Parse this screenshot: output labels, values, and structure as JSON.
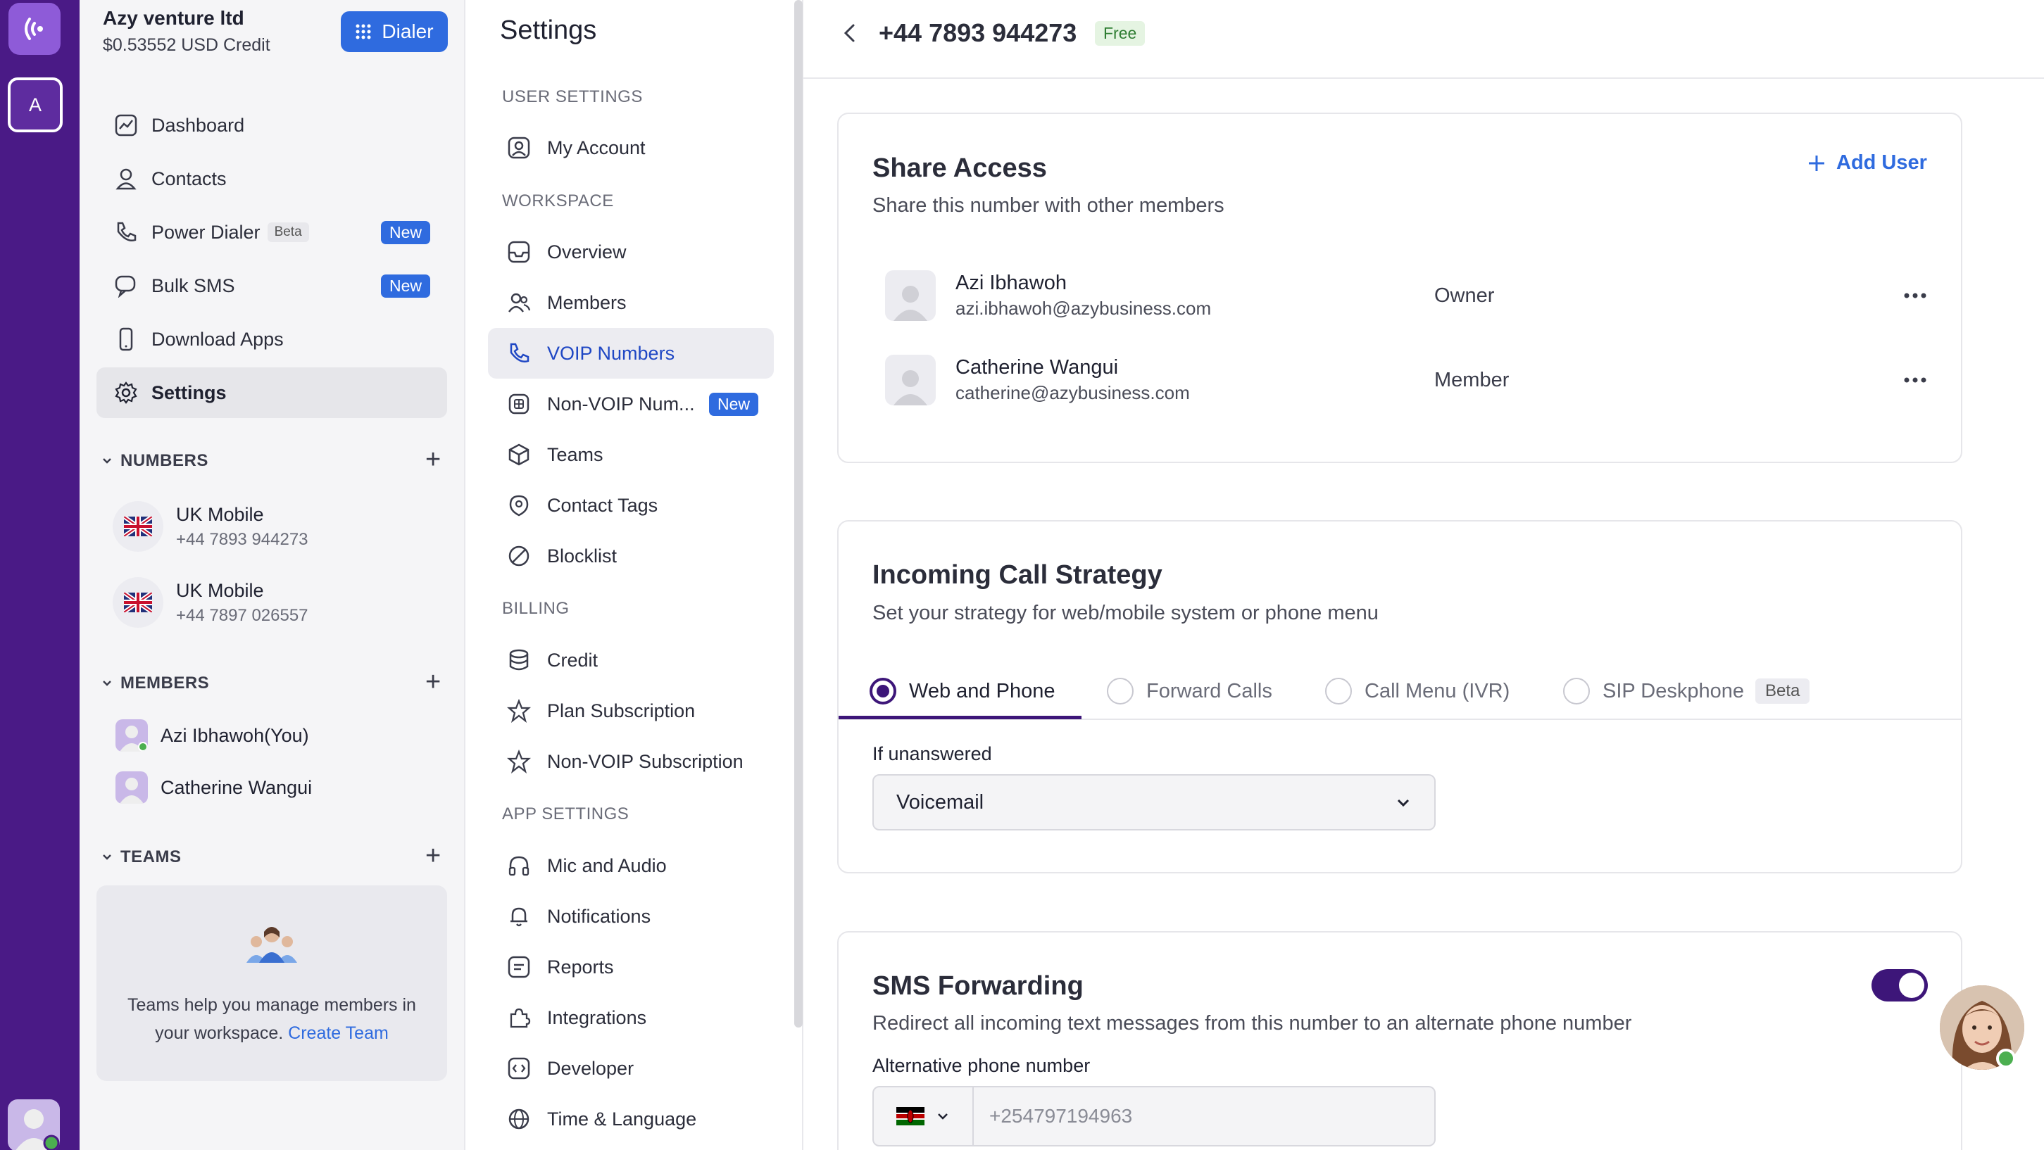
{
  "workspace": {
    "org_name": "Azy venture ltd",
    "credit": "$0.53552 USD Credit",
    "dialer_label": "Dialer",
    "rail_initial": "A"
  },
  "nav": {
    "items": [
      {
        "label": "Dashboard",
        "icon": "chart-icon"
      },
      {
        "label": "Contacts",
        "icon": "user-icon"
      },
      {
        "label": "Power Dialer",
        "icon": "phone-icon",
        "beta": "Beta",
        "badge": "New"
      },
      {
        "label": "Bulk SMS",
        "icon": "chat-icon",
        "badge": "New"
      },
      {
        "label": "Download Apps",
        "icon": "mobile-icon"
      },
      {
        "label": "Settings",
        "icon": "gear-icon",
        "active": true
      }
    ]
  },
  "numbers_section": {
    "title": "NUMBERS",
    "items": [
      {
        "title": "UK Mobile",
        "number": "+44 7893 944273"
      },
      {
        "title": "UK Mobile",
        "number": "+44 7897 026557"
      }
    ]
  },
  "members_section": {
    "title": "MEMBERS",
    "items": [
      {
        "name": "Azi Ibhawoh(You)"
      },
      {
        "name": "Catherine Wangui"
      }
    ]
  },
  "teams_section": {
    "title": "TEAMS",
    "empty_text": "Teams help you manage members in your workspace.",
    "link": "Create Team"
  },
  "settings": {
    "title": "Settings",
    "user_settings_head": "USER SETTINGS",
    "workspace_head": "WORKSPACE",
    "billing_head": "BILLING",
    "app_settings_head": "APP SETTINGS",
    "my_account": "My Account",
    "overview": "Overview",
    "members": "Members",
    "voip_numbers": "VOIP Numbers",
    "non_voip_numbers": "Non-VOIP Num...",
    "non_voip_badge": "New",
    "teams": "Teams",
    "contact_tags": "Contact Tags",
    "blocklist": "Blocklist",
    "credit": "Credit",
    "plan_subscription": "Plan Subscription",
    "non_voip_subscription": "Non-VOIP Subscription",
    "mic_audio": "Mic and Audio",
    "notifications": "Notifications",
    "reports": "Reports",
    "integrations": "Integrations",
    "developer": "Developer",
    "time_language": "Time & Language"
  },
  "header": {
    "phone": "+44 7893 944273",
    "plan_badge": "Free"
  },
  "share_access": {
    "title": "Share Access",
    "subtitle": "Share this number with other members",
    "add_user": "Add User",
    "users": [
      {
        "name": "Azi Ibhawoh",
        "email": "azi.ibhawoh@azybusiness.com",
        "role": "Owner"
      },
      {
        "name": "Catherine Wangui",
        "email": "catherine@azybusiness.com",
        "role": "Member"
      }
    ]
  },
  "incoming": {
    "title": "Incoming Call Strategy",
    "subtitle": "Set your strategy for web/mobile system or phone menu",
    "tabs": [
      "Web and Phone",
      "Forward Calls",
      "Call Menu (IVR)",
      "SIP Deskphone"
    ],
    "sip_beta": "Beta",
    "selected_tab": "Web and Phone",
    "unanswered_label": "If unanswered",
    "unanswered_value": "Voicemail"
  },
  "sms_forwarding": {
    "title": "SMS Forwarding",
    "subtitle": "Redirect all incoming text messages from this number to an alternate phone number",
    "enabled": true,
    "alt_label": "Alternative phone number",
    "alt_placeholder": "+254797194963"
  },
  "colors": {
    "rail": "#4a1a86",
    "accent": "#2f6bdf",
    "primary_purple": "#3d1679"
  }
}
